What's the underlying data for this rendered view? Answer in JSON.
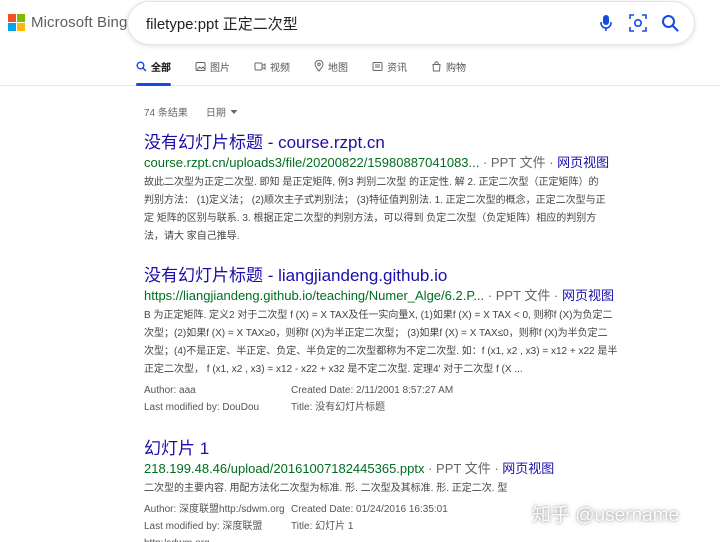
{
  "brand": {
    "name": "Microsoft Bing"
  },
  "search": {
    "query": "filetype:ppt 正定二次型"
  },
  "tabs": [
    {
      "label": "全部",
      "icon": "search-icon",
      "active": true
    },
    {
      "label": "图片",
      "icon": "image-icon"
    },
    {
      "label": "视频",
      "icon": "video-icon"
    },
    {
      "label": "地图",
      "icon": "map-pin-icon"
    },
    {
      "label": "资讯",
      "icon": "news-icon"
    },
    {
      "label": "购物",
      "icon": "shopping-icon"
    }
  ],
  "results_count": "74 条结果",
  "date_filter": "日期",
  "colors": {
    "link": "#1a0dab",
    "url": "#006d21",
    "accent": "#174ae4"
  },
  "results": [
    {
      "title": "没有幻灯片标题 - course.rzpt.cn",
      "url": "course.rzpt.cn/uploads3/file/20200822/15980887041083...",
      "filetype": " · PPT 文件 · ",
      "webpage": "网页视图",
      "snippet": [
        "故此二次型为正定二次型. 即知 是正定矩阵,  例3 判别二次型 的正定性. 解 2. 正定二次型（正定矩阵）的",
        "判别方法： (1)定义法； (2)顺次主子式判别法； (3)特征值判别法. 1. 正定二次型的概念，正定二次型与正",
        "定 矩阵的区别与联系.   3. 根据正定二次型的判别方法，可以得到 负定二次型（负定矩阵）相应的判别方",
        "法，请大 家自己推导."
      ]
    },
    {
      "title": "没有幻灯片标题 - liangjiandeng.github.io",
      "url": "https://liangjiandeng.github.io/teaching/Numer_Alge/6.2.P...",
      "filetype": " · PPT 文件 · ",
      "webpage": "网页视图",
      "snippet": [
        "B 为正定矩阵. 定义2 对于二次型 f (X) = X TAX及任一实向量X, (1)如果f (X) = X TAX < 0, 则称f (X)为负定二",
        "次型；(2)如果f (X) = X TAX≥0，则称f (X)为半正定二次型； (3)如果f (X) = X TAX≤0，则称f (X)为半负定二",
        "次型；(4)不是正定、半正定、负定、半负定的二次型都称为不定二次型. 如：f (x1, x2 , x3) = x12 + x22 是半",
        "正定二次型， f (x1, x2 , x3) = x12 - x22 + x32 是不定二次型. 定理4' 对于二次型 f (X ..."
      ],
      "meta": {
        "author": "Author: aaa",
        "created": "Created Date: 2/11/2001 8:57:27 AM",
        "modified": "Last modified by: DouDou",
        "doc_title": "Title: 没有幻灯片标题"
      }
    },
    {
      "title": "幻灯片 1",
      "url": "218.199.48.46/upload/20161007182445365.pptx",
      "filetype": " · PPT 文件 · ",
      "webpage": "网页视图",
      "snippet": [
        "二次型的主要内容. 用配方法化二次型为标准. 形. 二次型及其标准. 形. 正定二次. 型"
      ],
      "meta": {
        "author": "Author: 深度联盟http:/sdwm.org",
        "created": "Created Date: 01/24/2016 16:35:01",
        "modified": "Last modified by: 深度联盟http:/sdwm.org",
        "doc_title": "Title: 幻灯片 1"
      }
    }
  ],
  "watermark": "知乎 @username"
}
